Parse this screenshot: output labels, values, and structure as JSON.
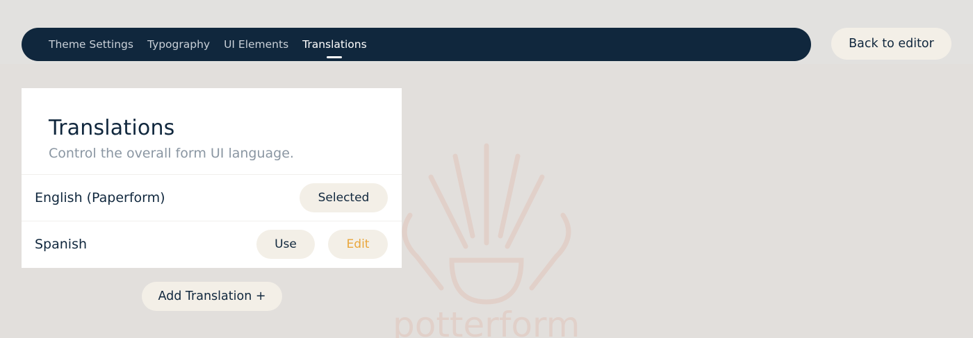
{
  "nav": {
    "tabs": [
      {
        "label": "Theme Settings",
        "active": false
      },
      {
        "label": "Typography",
        "active": false
      },
      {
        "label": "UI Elements",
        "active": false
      },
      {
        "label": "Translations",
        "active": true
      }
    ],
    "back_label": "Back to editor"
  },
  "card": {
    "title": "Translations",
    "subtitle": "Control the overall form UI language.",
    "rows": [
      {
        "label": "English (Paperform)",
        "selected_label": "Selected"
      },
      {
        "label": "Spanish",
        "use_label": "Use",
        "edit_label": "Edit"
      }
    ]
  },
  "add_translation_label": "Add Translation +",
  "colors": {
    "nav_bg": "#10273d",
    "pill_bg": "#f3efe7",
    "edit_accent": "#e9a63b",
    "page_bg": "#e2dfdc"
  },
  "background": {
    "watermark_icon": "potterform-logo-icon",
    "watermark_text": "potterform"
  }
}
